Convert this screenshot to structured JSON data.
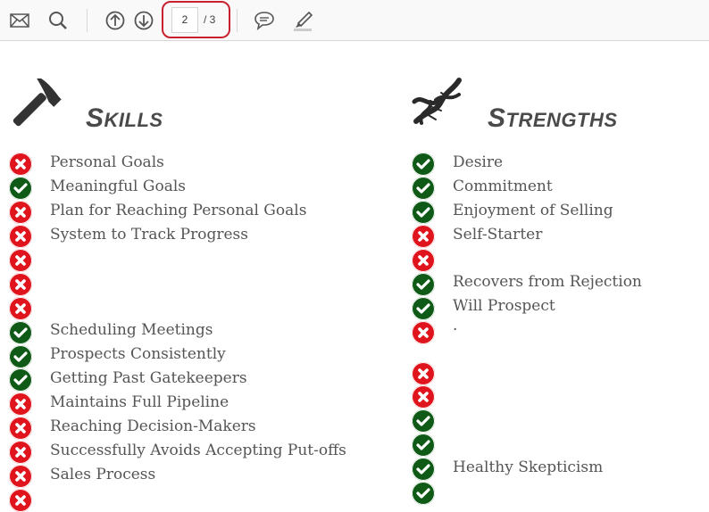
{
  "toolbar": {
    "page_current": "2",
    "page_total": "/ 3",
    "icons": [
      "mail-icon",
      "search-icon",
      "arrow-up-circle-icon",
      "arrow-down-circle-icon",
      "comment-icon",
      "highlighter-icon"
    ]
  },
  "skills": {
    "title_first": "S",
    "title_rest": "KILLS",
    "items": [
      {
        "status": "x",
        "label": "Personal Goals"
      },
      {
        "status": "check",
        "label": "Meaningful Goals"
      },
      {
        "status": "x",
        "label": "Plan for Reaching Personal Goals"
      },
      {
        "status": "x",
        "label": "System to Track Progress"
      },
      {
        "status": "x",
        "label": ""
      },
      {
        "status": "x",
        "label": ""
      },
      {
        "status": "x",
        "label": ""
      },
      {
        "status": "check",
        "label": "Scheduling Meetings"
      },
      {
        "status": "check",
        "label": "Prospects Consistently"
      },
      {
        "status": "check",
        "label": "Getting Past Gatekeepers"
      },
      {
        "status": "x",
        "label": "Maintains Full Pipeline"
      },
      {
        "status": "x",
        "label": "Reaching Decision-Makers"
      },
      {
        "status": "x",
        "label": "Successfully Avoids Accepting Put-offs"
      },
      {
        "status": "x",
        "label": "Sales Process"
      },
      {
        "status": "x",
        "label": ""
      }
    ]
  },
  "strengths": {
    "title_first": "S",
    "title_rest": "TRENGTHS",
    "items": [
      {
        "status": "check",
        "label": "Desire"
      },
      {
        "status": "check",
        "label": "Commitment"
      },
      {
        "status": "check",
        "label": "Enjoyment of Selling"
      },
      {
        "status": "x",
        "label": "Self-Starter"
      },
      {
        "status": "x",
        "label": ""
      },
      {
        "status": "check",
        "label": "Recovers from Rejection"
      },
      {
        "status": "check",
        "label": "Will Prospect"
      },
      {
        "status": "x",
        "label": "·"
      },
      {
        "status": "x",
        "label": ""
      },
      {
        "status": "x",
        "label": ""
      },
      {
        "status": "check",
        "label": ""
      },
      {
        "status": "check",
        "label": ""
      },
      {
        "status": "check",
        "label": "Healthy Skepticism"
      },
      {
        "status": "check",
        "label": ""
      }
    ]
  },
  "colors": {
    "x": "#e0141c",
    "check": "#0f5a17",
    "highlight": "#c8202f"
  }
}
